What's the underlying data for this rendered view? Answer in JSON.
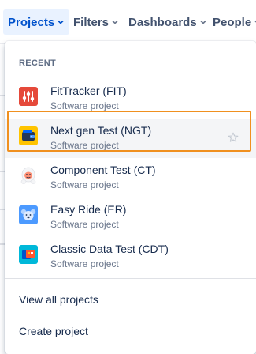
{
  "nav": {
    "items": [
      {
        "label": "Projects",
        "active": true
      },
      {
        "label": "Filters",
        "active": false
      },
      {
        "label": "Dashboards",
        "active": false
      },
      {
        "label": "People",
        "active": false
      }
    ]
  },
  "dropdown": {
    "section_label": "RECENT",
    "projects": [
      {
        "name": "FitTracker (FIT)",
        "type": "Software project",
        "icon": "fittracker-sliders-icon",
        "color": "#e5493a"
      },
      {
        "name": "Next gen Test (NGT)",
        "type": "Software project",
        "icon": "wallet-icon",
        "color": "#ffc400",
        "highlighted": true
      },
      {
        "name": "Component Test (CT)",
        "type": "Software project",
        "icon": "yeti-icon",
        "color": "#ffffff"
      },
      {
        "name": "Easy Ride (ER)",
        "type": "Software project",
        "icon": "koala-icon",
        "color": "#4c9aff"
      },
      {
        "name": "Classic Data Test (CDT)",
        "type": "Software project",
        "icon": "folder-icon",
        "color": "#00b8d9"
      }
    ],
    "actions": [
      {
        "label": "View all projects"
      },
      {
        "label": "Create project"
      }
    ]
  },
  "colors": {
    "accent": "#0052cc",
    "focus_ring": "#f0901f"
  }
}
